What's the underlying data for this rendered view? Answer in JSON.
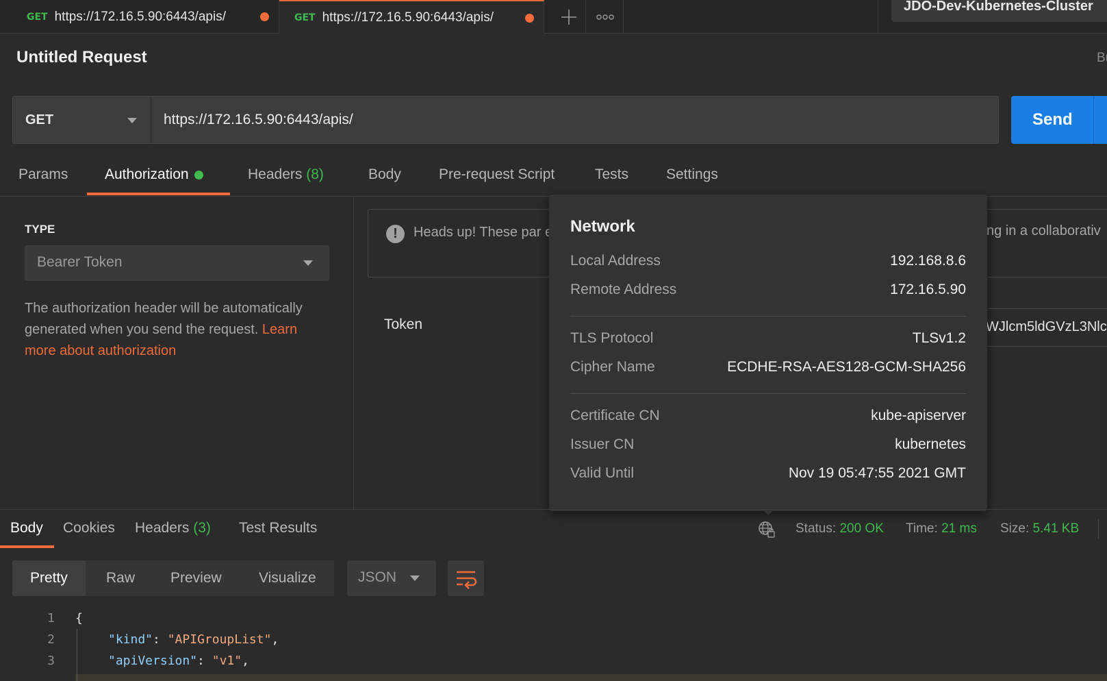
{
  "tabs": [
    {
      "method": "GET",
      "url": "https://172.16.5.90:6443/apis/"
    },
    {
      "method": "GET",
      "url": "https://172.16.5.90:6443/apis/"
    }
  ],
  "tab_controls": {
    "add": "+",
    "more": "ooo"
  },
  "environment": "JDO-Dev-Kubernetes-Cluster",
  "request": {
    "title": "Untitled Request",
    "build_edge": "Bu",
    "method": "GET",
    "url": "https://172.16.5.90:6443/apis/",
    "send_label": "Send"
  },
  "request_tabs": {
    "params": "Params",
    "authorization": "Authorization",
    "headers": "Headers",
    "headers_count": "(8)",
    "body": "Body",
    "prerequest": "Pre-request Script",
    "tests": "Tests",
    "settings": "Settings"
  },
  "auth": {
    "type_label": "TYPE",
    "type_value": "Bearer Token",
    "help_text": "The authorization header will be automatically generated when you send the request. ",
    "help_link": "Learn more about authorization",
    "headsup_text": "Heads up! These par environment, we rec",
    "headsup_tail": "ng in a collaborativ",
    "token_label": "Token",
    "token_value": "WJlcm5ldGVzL3Nlc"
  },
  "network": {
    "title": "Network",
    "rows": [
      {
        "key": "Local Address",
        "value": "192.168.8.6"
      },
      {
        "key": "Remote Address",
        "value": "172.16.5.90"
      },
      {
        "key": "TLS Protocol",
        "value": "TLSv1.2"
      },
      {
        "key": "Cipher Name",
        "value": "ECDHE-RSA-AES128-GCM-SHA256"
      },
      {
        "key": "Certificate CN",
        "value": "kube-apiserver"
      },
      {
        "key": "Issuer CN",
        "value": "kubernetes"
      },
      {
        "key": "Valid Until",
        "value": "Nov 19 05:47:55 2021 GMT"
      }
    ]
  },
  "response": {
    "tabs": {
      "body": "Body",
      "cookies": "Cookies",
      "headers": "Headers",
      "headers_count": "(3)",
      "test_results": "Test Results"
    },
    "status_label": "Status:",
    "status_value": "200 OK",
    "time_label": "Time:",
    "time_value": "21 ms",
    "size_label": "Size:",
    "size_value": "5.41 KB",
    "views": {
      "pretty": "Pretty",
      "raw": "Raw",
      "preview": "Preview",
      "visualize": "Visualize"
    },
    "format": "JSON",
    "code": {
      "line1_no": "1",
      "line1": "{",
      "line2_no": "2",
      "line2_key": "\"kind\"",
      "line2_sep": ": ",
      "line2_val": "\"APIGroupList\"",
      "line2_end": ",",
      "line3_no": "3",
      "line3_key": "\"apiVersion\"",
      "line3_sep": ": ",
      "line3_val": "\"v1\"",
      "line3_end": ","
    }
  },
  "colors": {
    "accent": "#f26b3a",
    "send": "#1a7ee6",
    "success": "#3fb950",
    "background": "#2b2b2b"
  }
}
